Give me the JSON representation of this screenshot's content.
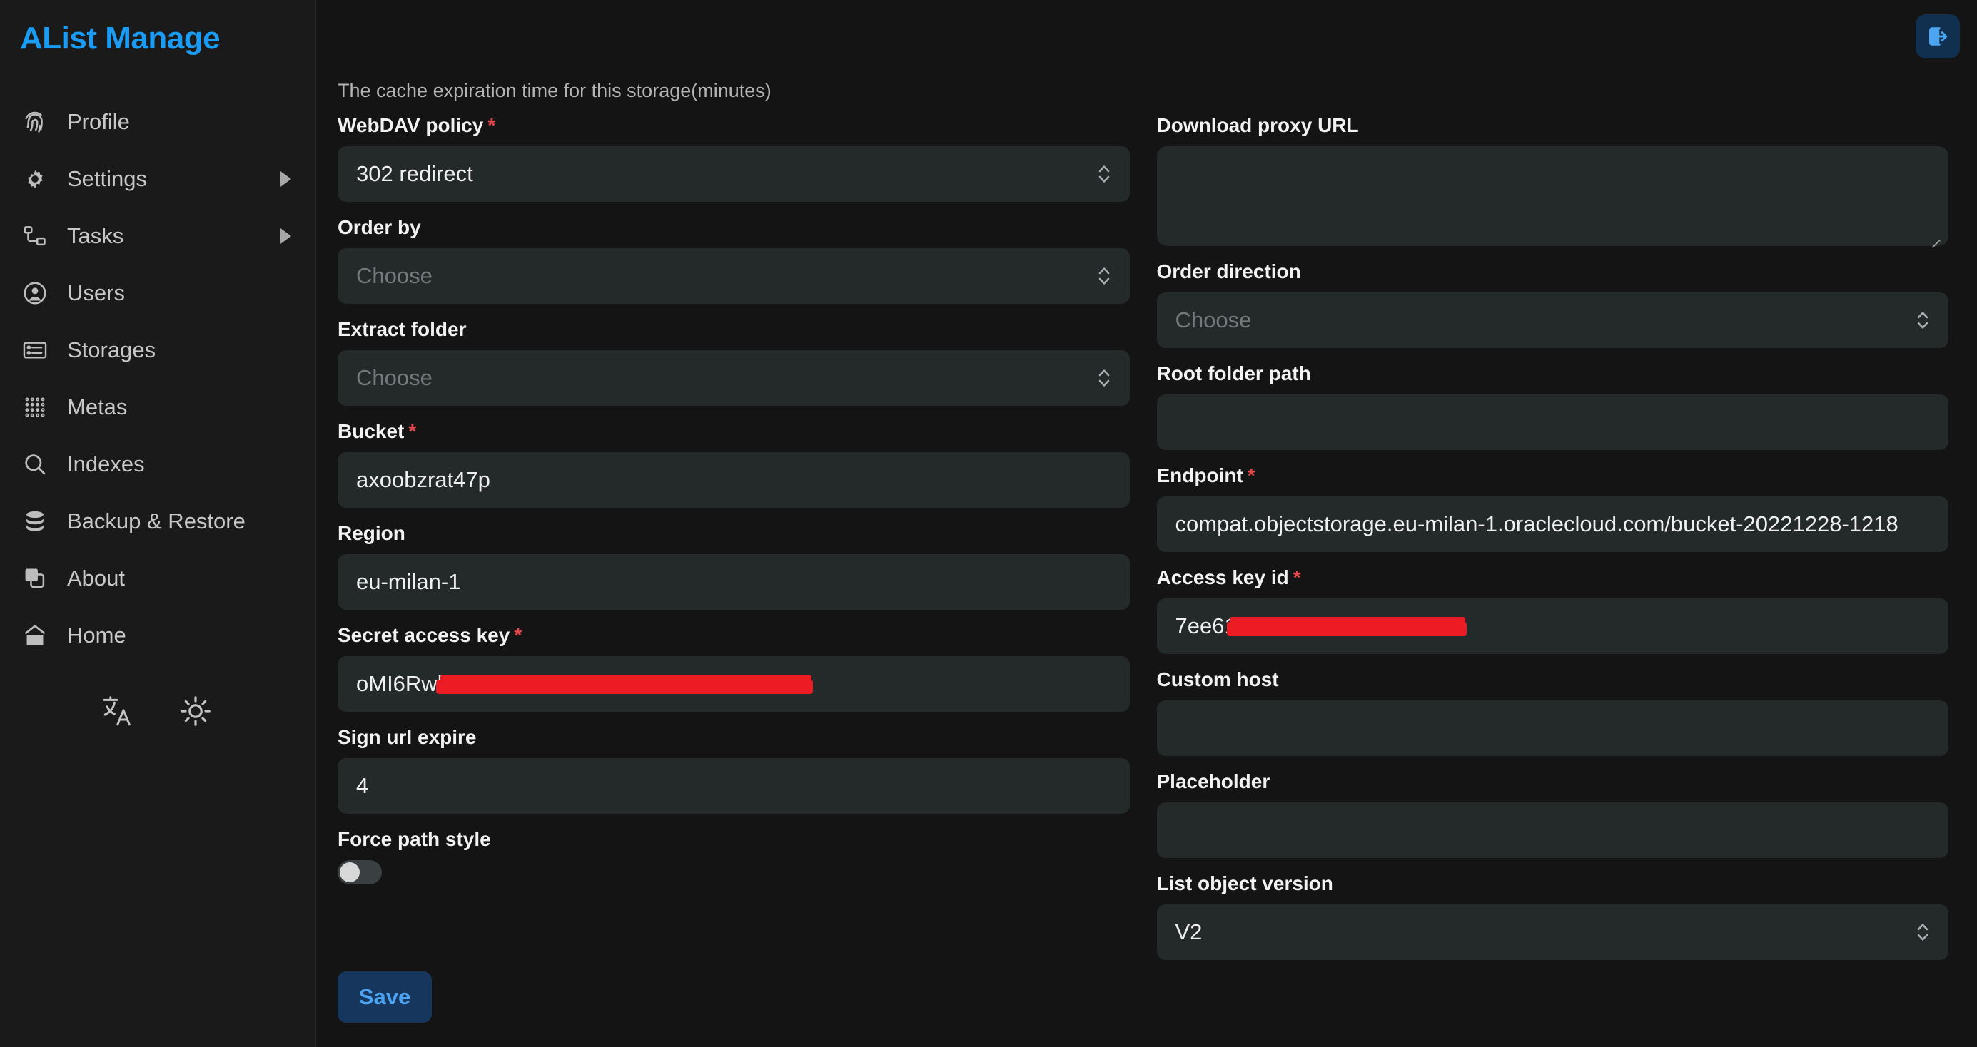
{
  "brand": {
    "title": "AList Manage"
  },
  "colors": {
    "accent": "#1a9cf5",
    "required": "#e5484d",
    "save_bg": "#16365e",
    "save_text": "#4ba3f2",
    "redaction": "#ed1c24",
    "sidebar_bg": "#1a1a1a",
    "main_bg": "#141414",
    "field_bg": "#24292a"
  },
  "sidebar": {
    "items": [
      {
        "label": "Profile",
        "icon": "fingerprint-icon",
        "expandable": false
      },
      {
        "label": "Settings",
        "icon": "gear-icon",
        "expandable": true
      },
      {
        "label": "Tasks",
        "icon": "tasks-icon",
        "expandable": true
      },
      {
        "label": "Users",
        "icon": "user-circle-icon",
        "expandable": false
      },
      {
        "label": "Storages",
        "icon": "server-icon",
        "expandable": false
      },
      {
        "label": "Metas",
        "icon": "dots-grid-icon",
        "expandable": false
      },
      {
        "label": "Indexes",
        "icon": "search-icon",
        "expandable": false
      },
      {
        "label": "Backup & Restore",
        "icon": "database-icon",
        "expandable": false
      },
      {
        "label": "About",
        "icon": "layers-icon",
        "expandable": false
      },
      {
        "label": "Home",
        "icon": "home-icon",
        "expandable": false
      }
    ],
    "tools": [
      {
        "name": "language-icon"
      },
      {
        "name": "theme-sun-icon"
      }
    ]
  },
  "topbar": {
    "logout_icon": "logout-icon"
  },
  "main": {
    "helper_top": "The cache expiration time for this storage(minutes)",
    "left": [
      {
        "key": "webdav_policy",
        "label": "WebDAV policy",
        "required": true,
        "type": "select",
        "value": "302 redirect",
        "placeholder": ""
      },
      {
        "key": "order_by",
        "label": "Order by",
        "required": false,
        "type": "select",
        "value": "",
        "placeholder": "Choose"
      },
      {
        "key": "extract_folder",
        "label": "Extract folder",
        "required": false,
        "type": "select",
        "value": "",
        "placeholder": "Choose"
      },
      {
        "key": "bucket",
        "label": "Bucket",
        "required": true,
        "type": "text",
        "value": "axoobzrat47p",
        "placeholder": ""
      },
      {
        "key": "region",
        "label": "Region",
        "required": false,
        "type": "text",
        "value": "eu-milan-1",
        "placeholder": ""
      },
      {
        "key": "secret_access_key",
        "label": "Secret access key",
        "required": true,
        "type": "redacted",
        "value": "oMI6Rwb",
        "placeholder": ""
      },
      {
        "key": "sign_url_expire",
        "label": "Sign url expire",
        "required": false,
        "type": "text",
        "value": "4",
        "placeholder": ""
      },
      {
        "key": "force_path_style",
        "label": "Force path style",
        "required": false,
        "type": "toggle",
        "value": "off",
        "placeholder": ""
      }
    ],
    "right": [
      {
        "key": "download_proxy_url",
        "label": "Download proxy URL",
        "required": false,
        "type": "textarea",
        "value": "",
        "placeholder": ""
      },
      {
        "key": "order_direction",
        "label": "Order direction",
        "required": false,
        "type": "select",
        "value": "",
        "placeholder": "Choose"
      },
      {
        "key": "root_folder_path",
        "label": "Root folder path",
        "required": false,
        "type": "text",
        "value": "",
        "placeholder": ""
      },
      {
        "key": "endpoint",
        "label": "Endpoint",
        "required": true,
        "type": "text",
        "value": "compat.objectstorage.eu-milan-1.oraclecloud.com/bucket-20221228-1218",
        "placeholder": ""
      },
      {
        "key": "access_key_id",
        "label": "Access key id",
        "required": true,
        "type": "redacted",
        "value": "7ee612",
        "placeholder": ""
      },
      {
        "key": "custom_host",
        "label": "Custom host",
        "required": false,
        "type": "text",
        "value": "",
        "placeholder": ""
      },
      {
        "key": "placeholder_field",
        "label": "Placeholder",
        "required": false,
        "type": "text",
        "value": "",
        "placeholder": ""
      },
      {
        "key": "list_object_version",
        "label": "List object version",
        "required": false,
        "type": "select",
        "value": "V2",
        "placeholder": ""
      }
    ],
    "save_label": "Save"
  }
}
